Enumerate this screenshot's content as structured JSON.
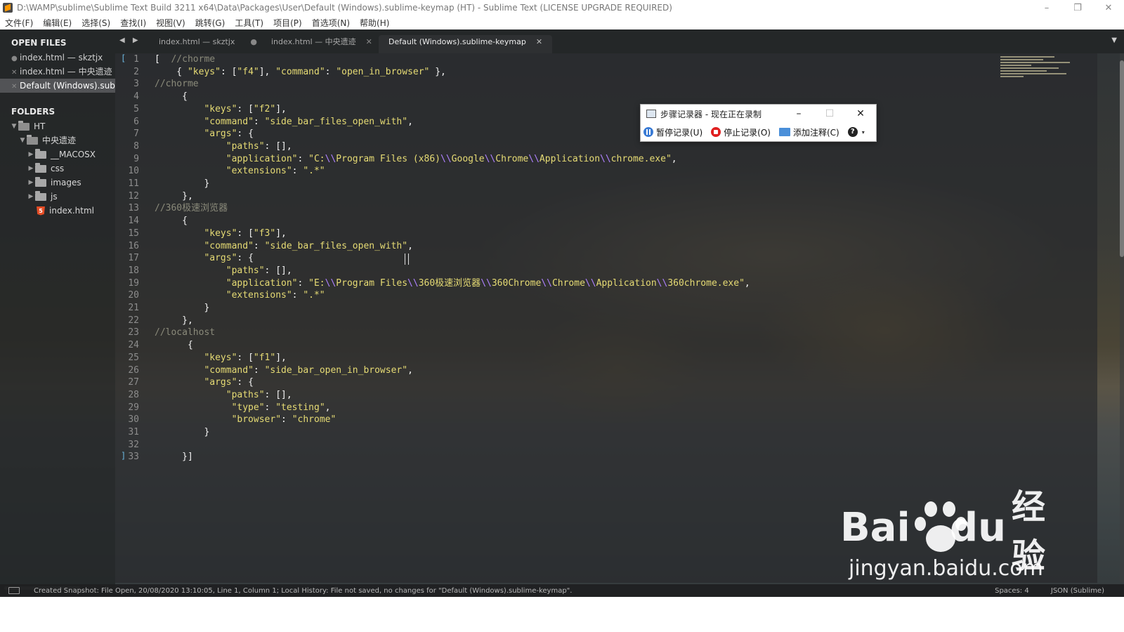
{
  "window": {
    "title": "D:\\WAMP\\sublime\\Sublime Text Build 3211 x64\\Data\\Packages\\User\\Default (Windows).sublime-keymap (HT) - Sublime Text (LICENSE UPGRADE REQUIRED)",
    "minimize": "–",
    "restore": "❐",
    "close": "✕"
  },
  "menu": [
    "文件(F)",
    "编辑(E)",
    "选择(S)",
    "查找(I)",
    "视图(V)",
    "跳转(G)",
    "工具(T)",
    "项目(P)",
    "首选项(N)",
    "帮助(H)"
  ],
  "sidebar": {
    "open_files_heading": "OPEN FILES",
    "open_files": [
      {
        "label": "index.html — skztjx",
        "mark": "●"
      },
      {
        "label": "index.html — 中央遗迹",
        "mark": "✕"
      },
      {
        "label": "Default (Windows).sublime-keymap",
        "mark": "✕",
        "active": true
      }
    ],
    "folders_heading": "FOLDERS",
    "tree": {
      "root": "HT",
      "sub": "中央遗迹",
      "children": [
        "__MACOSX",
        "css",
        "images",
        "js"
      ],
      "file": "index.html"
    }
  },
  "tabs": [
    {
      "label": "index.html — skztjx",
      "mark": "●"
    },
    {
      "label": "index.html — 中央遗迹",
      "mark": "✕"
    },
    {
      "label": "Default (Windows).sublime-keymap",
      "mark": "✕",
      "active": true
    }
  ],
  "tab_nav": "◀ ▶",
  "tab_menu": "▼",
  "code_lines": [
    [
      {
        "t": "[  "
      },
      {
        "t": "//chorme",
        "c": "cmt"
      }
    ],
    [
      {
        "t": "    { "
      },
      {
        "t": "\"keys\"",
        "c": "str"
      },
      {
        "t": ": ["
      },
      {
        "t": "\"f4\"",
        "c": "str"
      },
      {
        "t": "], "
      },
      {
        "t": "\"command\"",
        "c": "str"
      },
      {
        "t": ": "
      },
      {
        "t": "\"open_in_browser\"",
        "c": "str"
      },
      {
        "t": " },"
      }
    ],
    [
      {
        "t": "//chorme",
        "c": "cmt"
      }
    ],
    [
      {
        "t": "     {"
      }
    ],
    [
      {
        "t": "         "
      },
      {
        "t": "\"keys\"",
        "c": "str"
      },
      {
        "t": ": ["
      },
      {
        "t": "\"f2\"",
        "c": "str"
      },
      {
        "t": "],"
      }
    ],
    [
      {
        "t": "         "
      },
      {
        "t": "\"command\"",
        "c": "str"
      },
      {
        "t": ": "
      },
      {
        "t": "\"side_bar_files_open_with\"",
        "c": "str"
      },
      {
        "t": ","
      }
    ],
    [
      {
        "t": "         "
      },
      {
        "t": "\"args\"",
        "c": "str"
      },
      {
        "t": ": {"
      }
    ],
    [
      {
        "t": "             "
      },
      {
        "t": "\"paths\"",
        "c": "str"
      },
      {
        "t": ": [],"
      }
    ],
    [
      {
        "t": "             "
      },
      {
        "t": "\"application\"",
        "c": "str"
      },
      {
        "t": ": "
      },
      {
        "t": "\"C:",
        "c": "str"
      },
      {
        "t": "\\\\",
        "c": "esc"
      },
      {
        "t": "Program Files (x86)",
        "c": "str"
      },
      {
        "t": "\\\\",
        "c": "esc"
      },
      {
        "t": "Google",
        "c": "str"
      },
      {
        "t": "\\\\",
        "c": "esc"
      },
      {
        "t": "Chrome",
        "c": "str"
      },
      {
        "t": "\\\\",
        "c": "esc"
      },
      {
        "t": "Application",
        "c": "str"
      },
      {
        "t": "\\\\",
        "c": "esc"
      },
      {
        "t": "chrome.exe\"",
        "c": "str"
      },
      {
        "t": ","
      }
    ],
    [
      {
        "t": "             "
      },
      {
        "t": "\"extensions\"",
        "c": "str"
      },
      {
        "t": ": "
      },
      {
        "t": "\".*\"",
        "c": "str"
      }
    ],
    [
      {
        "t": "         }"
      }
    ],
    [
      {
        "t": "     },"
      }
    ],
    [
      {
        "t": "//360极速浏览器",
        "c": "cmt"
      }
    ],
    [
      {
        "t": "     {"
      }
    ],
    [
      {
        "t": "         "
      },
      {
        "t": "\"keys\"",
        "c": "str"
      },
      {
        "t": ": ["
      },
      {
        "t": "\"f3\"",
        "c": "str"
      },
      {
        "t": "],"
      }
    ],
    [
      {
        "t": "         "
      },
      {
        "t": "\"command\"",
        "c": "str"
      },
      {
        "t": ": "
      },
      {
        "t": "\"side_bar_files_open_with\"",
        "c": "str"
      },
      {
        "t": ","
      }
    ],
    [
      {
        "t": "         "
      },
      {
        "t": "\"args\"",
        "c": "str"
      },
      {
        "t": ": {"
      }
    ],
    [
      {
        "t": "             "
      },
      {
        "t": "\"paths\"",
        "c": "str"
      },
      {
        "t": ": [],"
      }
    ],
    [
      {
        "t": "             "
      },
      {
        "t": "\"application\"",
        "c": "str"
      },
      {
        "t": ": "
      },
      {
        "t": "\"E:",
        "c": "str"
      },
      {
        "t": "\\\\",
        "c": "esc"
      },
      {
        "t": "Program Files",
        "c": "str"
      },
      {
        "t": "\\\\",
        "c": "esc"
      },
      {
        "t": "360极速浏览器",
        "c": "str"
      },
      {
        "t": "\\\\",
        "c": "esc"
      },
      {
        "t": "360Chrome",
        "c": "str"
      },
      {
        "t": "\\\\",
        "c": "esc"
      },
      {
        "t": "Chrome",
        "c": "str"
      },
      {
        "t": "\\\\",
        "c": "esc"
      },
      {
        "t": "Application",
        "c": "str"
      },
      {
        "t": "\\\\",
        "c": "esc"
      },
      {
        "t": "360chrome.exe\"",
        "c": "str"
      },
      {
        "t": ","
      }
    ],
    [
      {
        "t": "             "
      },
      {
        "t": "\"extensions\"",
        "c": "str"
      },
      {
        "t": ": "
      },
      {
        "t": "\".*\"",
        "c": "str"
      }
    ],
    [
      {
        "t": "         }"
      }
    ],
    [
      {
        "t": "     },"
      }
    ],
    [
      {
        "t": "//localhost",
        "c": "cmt"
      }
    ],
    [
      {
        "t": "      {"
      }
    ],
    [
      {
        "t": "         "
      },
      {
        "t": "\"keys\"",
        "c": "str"
      },
      {
        "t": ": ["
      },
      {
        "t": "\"f1\"",
        "c": "str"
      },
      {
        "t": "],"
      }
    ],
    [
      {
        "t": "         "
      },
      {
        "t": "\"command\"",
        "c": "str"
      },
      {
        "t": ": "
      },
      {
        "t": "\"side_bar_open_in_browser\"",
        "c": "str"
      },
      {
        "t": ","
      }
    ],
    [
      {
        "t": "         "
      },
      {
        "t": "\"args\"",
        "c": "str"
      },
      {
        "t": ": {"
      }
    ],
    [
      {
        "t": "             "
      },
      {
        "t": "\"paths\"",
        "c": "str"
      },
      {
        "t": ": [],"
      }
    ],
    [
      {
        "t": "              "
      },
      {
        "t": "\"type\"",
        "c": "str"
      },
      {
        "t": ": "
      },
      {
        "t": "\"testing\"",
        "c": "str"
      },
      {
        "t": ","
      }
    ],
    [
      {
        "t": "              "
      },
      {
        "t": "\"browser\"",
        "c": "str"
      },
      {
        "t": ": "
      },
      {
        "t": "\"chrome\"",
        "c": "str"
      }
    ],
    [
      {
        "t": "         }"
      }
    ],
    [
      {
        "t": ""
      }
    ],
    [
      {
        "t": "     }]"
      }
    ]
  ],
  "status": {
    "message": "Created Snapshot: File Open, 20/08/2020 13:10:05, Line 1, Column 1; Local History: File not saved, no changes for \"Default (Windows).sublime-keymap\".",
    "spaces": "Spaces: 4",
    "syntax": "JSON (Sublime)"
  },
  "recorder": {
    "title": "步骤记录器 - 现在正在录制",
    "minimize": "–",
    "maximize": "☐",
    "close": "✕",
    "pause_label": "暂停记录(U)",
    "stop_label": "停止记录(O)",
    "comment_label": "添加注释(C)",
    "help_glyph": "?",
    "help_arrow": "▾"
  },
  "watermark": {
    "brand_left": "Bai",
    "brand_right": "du",
    "cn": "经验",
    "url": "jingyan.baidu.com"
  }
}
